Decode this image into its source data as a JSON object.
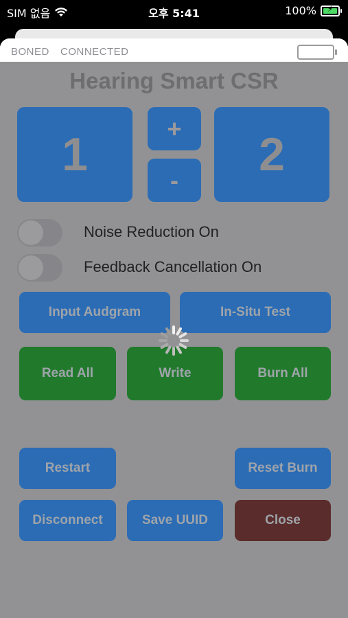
{
  "status_bar": {
    "carrier": "SIM 없음",
    "time": "오후 5:41",
    "battery_percent": "100%",
    "battery_level": 1.0,
    "icons": [
      "wifi-icon",
      "charging-battery-icon"
    ]
  },
  "device_bar": {
    "bond_state": "BONED",
    "connection_state": "CONNECTED"
  },
  "app": {
    "title": "Hearing Smart CSR",
    "channel_left": "1",
    "channel_right": "2",
    "plus_label": "+",
    "minus_label": "-",
    "noise_reduction": {
      "label": "Noise Reduction On",
      "on": false
    },
    "feedback_cancellation": {
      "label": "Feedback Cancellation On",
      "on": false
    },
    "buttons": {
      "input_audgram": "Input Audgram",
      "in_situ_test": "In-Situ Test",
      "read_all": "Read All",
      "write": "Write",
      "burn_all": "Burn All",
      "restart": "Restart",
      "reset_burn": "Reset Burn",
      "disconnect": "Disconnect",
      "save_uuid": "Save UUID",
      "close": "Close"
    }
  },
  "colors": {
    "blue_button": "#2b6cb5",
    "green_button": "#217a2c",
    "close_button": "#5a2c2b",
    "overlay_gray": "#929294",
    "battery_green": "#4cd964"
  }
}
